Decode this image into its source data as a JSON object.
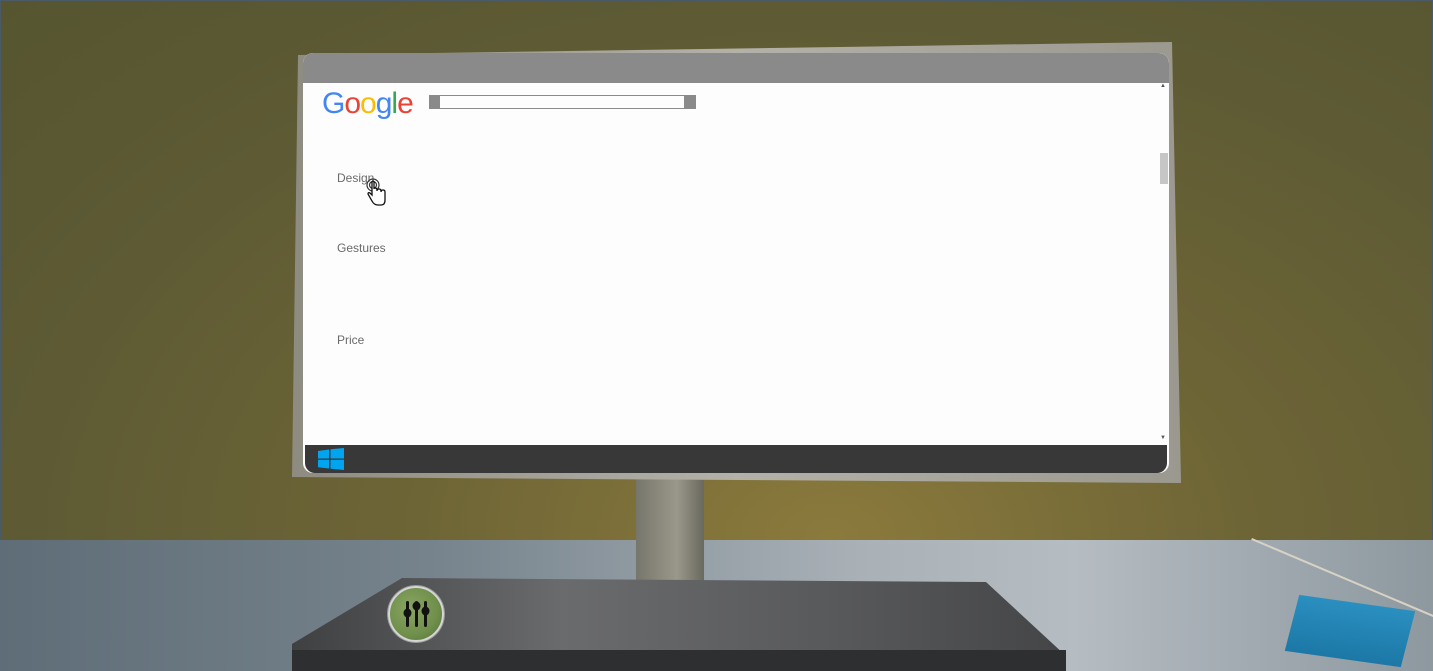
{
  "scene": {
    "settings_icon": "equalizer-sliders-icon",
    "colors": {
      "wall": "#6b6535",
      "desk": "#8d989f",
      "keyboard": "#58595b",
      "knob": "#6f8f4b",
      "blue_box": "#2a8fc0"
    }
  },
  "browser": {
    "logo_letters": [
      {
        "char": "G",
        "color": "#4285F4"
      },
      {
        "char": "o",
        "color": "#EA4335"
      },
      {
        "char": "o",
        "color": "#FBBC05"
      },
      {
        "char": "g",
        "color": "#4285F4"
      },
      {
        "char": "l",
        "color": "#34A853"
      },
      {
        "char": "e",
        "color": "#EA4335"
      }
    ],
    "search": {
      "value": "",
      "placeholder": ""
    },
    "menu": {
      "design": "Design",
      "gestures": "Gestures",
      "price": "Price"
    },
    "cursor_icon": "hand-pointer-icon"
  },
  "taskbar": {
    "start_icon": "windows-logo-icon",
    "color": "#383838",
    "start_color": "#00a4ef"
  }
}
